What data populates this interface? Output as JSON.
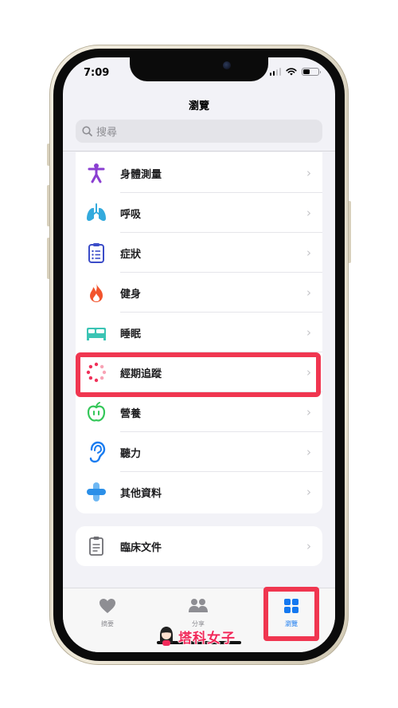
{
  "status_bar": {
    "time": "7:09"
  },
  "nav": {
    "title": "瀏覽"
  },
  "search": {
    "placeholder": "搜尋"
  },
  "categories": [
    {
      "label": "身體測量",
      "icon": "body-measurement-icon",
      "color": "#8a3fd1"
    },
    {
      "label": "呼吸",
      "icon": "lungs-icon",
      "color": "#33aadd"
    },
    {
      "label": "症狀",
      "icon": "clipboard-icon",
      "color": "#3b4cc8"
    },
    {
      "label": "健身",
      "icon": "flame-icon",
      "color": "#f2542d"
    },
    {
      "label": "睡眠",
      "icon": "bed-icon",
      "color": "#3bc4b4"
    },
    {
      "label": "經期追蹤",
      "icon": "cycle-tracking-icon",
      "color": "#f0325a"
    },
    {
      "label": "營養",
      "icon": "apple-icon",
      "color": "#34c759"
    },
    {
      "label": "聽力",
      "icon": "ear-icon",
      "color": "#1a7cf0"
    },
    {
      "label": "其他資料",
      "icon": "plus-cross-icon",
      "color": "#2b8fe8"
    }
  ],
  "clinical": {
    "label": "臨床文件",
    "icon": "document-icon",
    "color": "#6e6e73"
  },
  "tabs": [
    {
      "label": "摘要",
      "icon": "heart-icon"
    },
    {
      "label": "分享",
      "icon": "people-icon"
    },
    {
      "label": "瀏覽",
      "icon": "grid-icon"
    }
  ],
  "watermark": {
    "text": "塔科女子"
  },
  "colors": {
    "accent": "#1478f0",
    "highlight": "#f03650",
    "chevron": "#c4c4c8"
  }
}
